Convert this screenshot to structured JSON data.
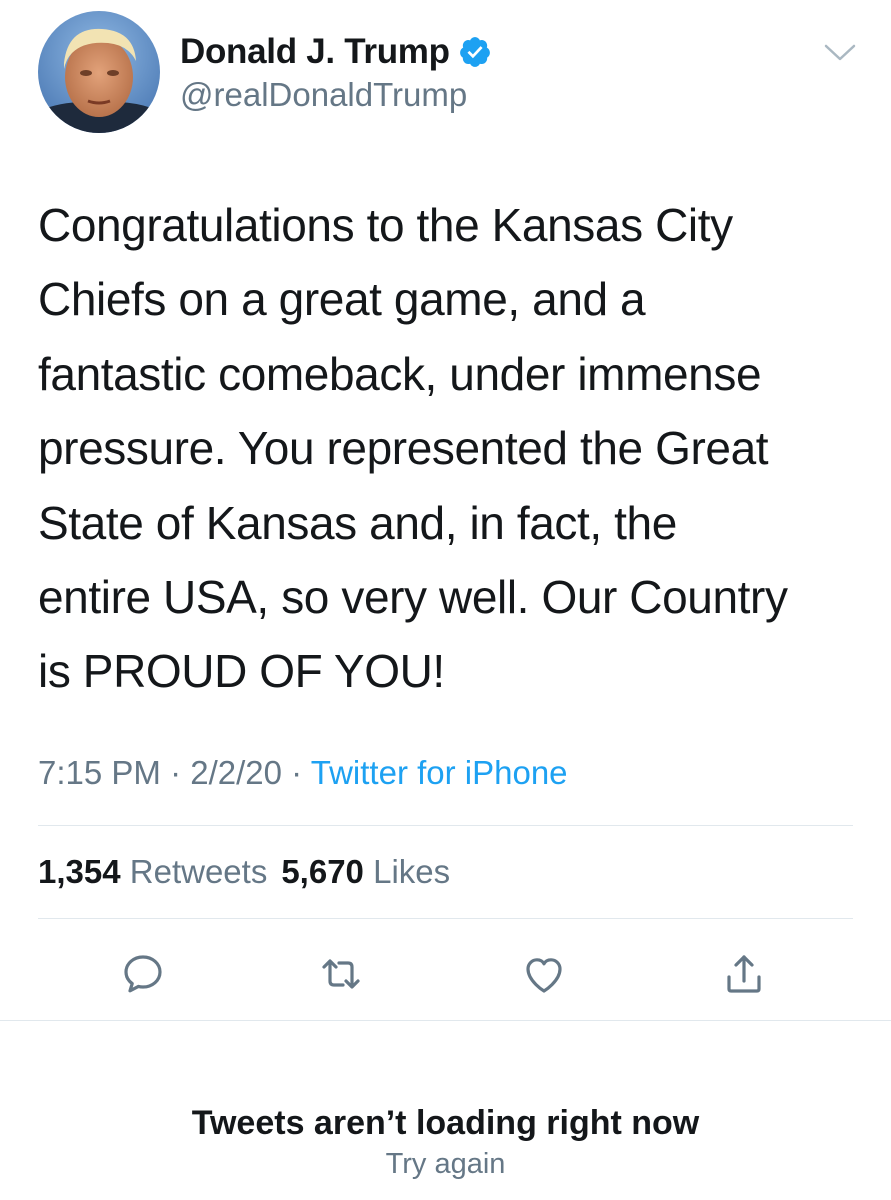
{
  "author": {
    "display_name": "Donald J. Trump",
    "handle": "@realDonaldTrump",
    "verified": true,
    "avatar_icon": "profile-photo"
  },
  "tweet": {
    "text": "Congratulations to the Kansas City\nChiefs on a great game, and a\nfantastic comeback, under immense\npressure. You represented the Great\nState of Kansas and, in fact, the\nentire USA, so very well. Our Country\nis PROUD OF YOU!",
    "time": "7:15 PM",
    "date": "2/2/20",
    "separator": "·",
    "source": "Twitter for iPhone"
  },
  "stats": {
    "retweets_count": "1,354",
    "retweets_label": "Retweets",
    "likes_count": "5,670",
    "likes_label": "Likes"
  },
  "actions": [
    {
      "name": "reply",
      "icon": "reply-icon"
    },
    {
      "name": "retweet",
      "icon": "retweet-icon"
    },
    {
      "name": "like",
      "icon": "heart-icon"
    },
    {
      "name": "share",
      "icon": "share-icon"
    }
  ],
  "footer": {
    "message": "Tweets aren’t loading right now",
    "retry_label": "Try again"
  },
  "colors": {
    "accent": "#1da1f2",
    "text_primary": "#14171a",
    "text_secondary": "#657786",
    "divider": "#e1e8ed"
  }
}
